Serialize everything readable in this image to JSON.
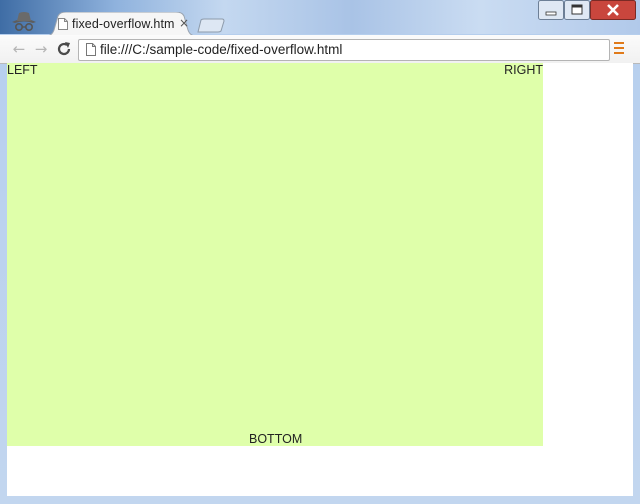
{
  "browser": {
    "tab": {
      "title": "fixed-overflow.htm",
      "close_glyph": "×",
      "favicon": "page-icon"
    },
    "window_controls": {
      "minimize_icon": "minimize-icon",
      "maximize_icon": "maximize-icon",
      "close_icon": "close-icon"
    },
    "toolbar": {
      "back_glyph": "←",
      "forward_glyph": "→",
      "reload_glyph": "C",
      "url": "file:///C:/sample-code/fixed-overflow.html",
      "page_icon": "page-icon",
      "menu_icon": "hamburger-menu-icon"
    }
  },
  "page": {
    "fixed_box_color": "#dfffaa",
    "labels": {
      "left": "LEFT",
      "right": "RIGHT",
      "bottom": "BOTTOM"
    }
  }
}
